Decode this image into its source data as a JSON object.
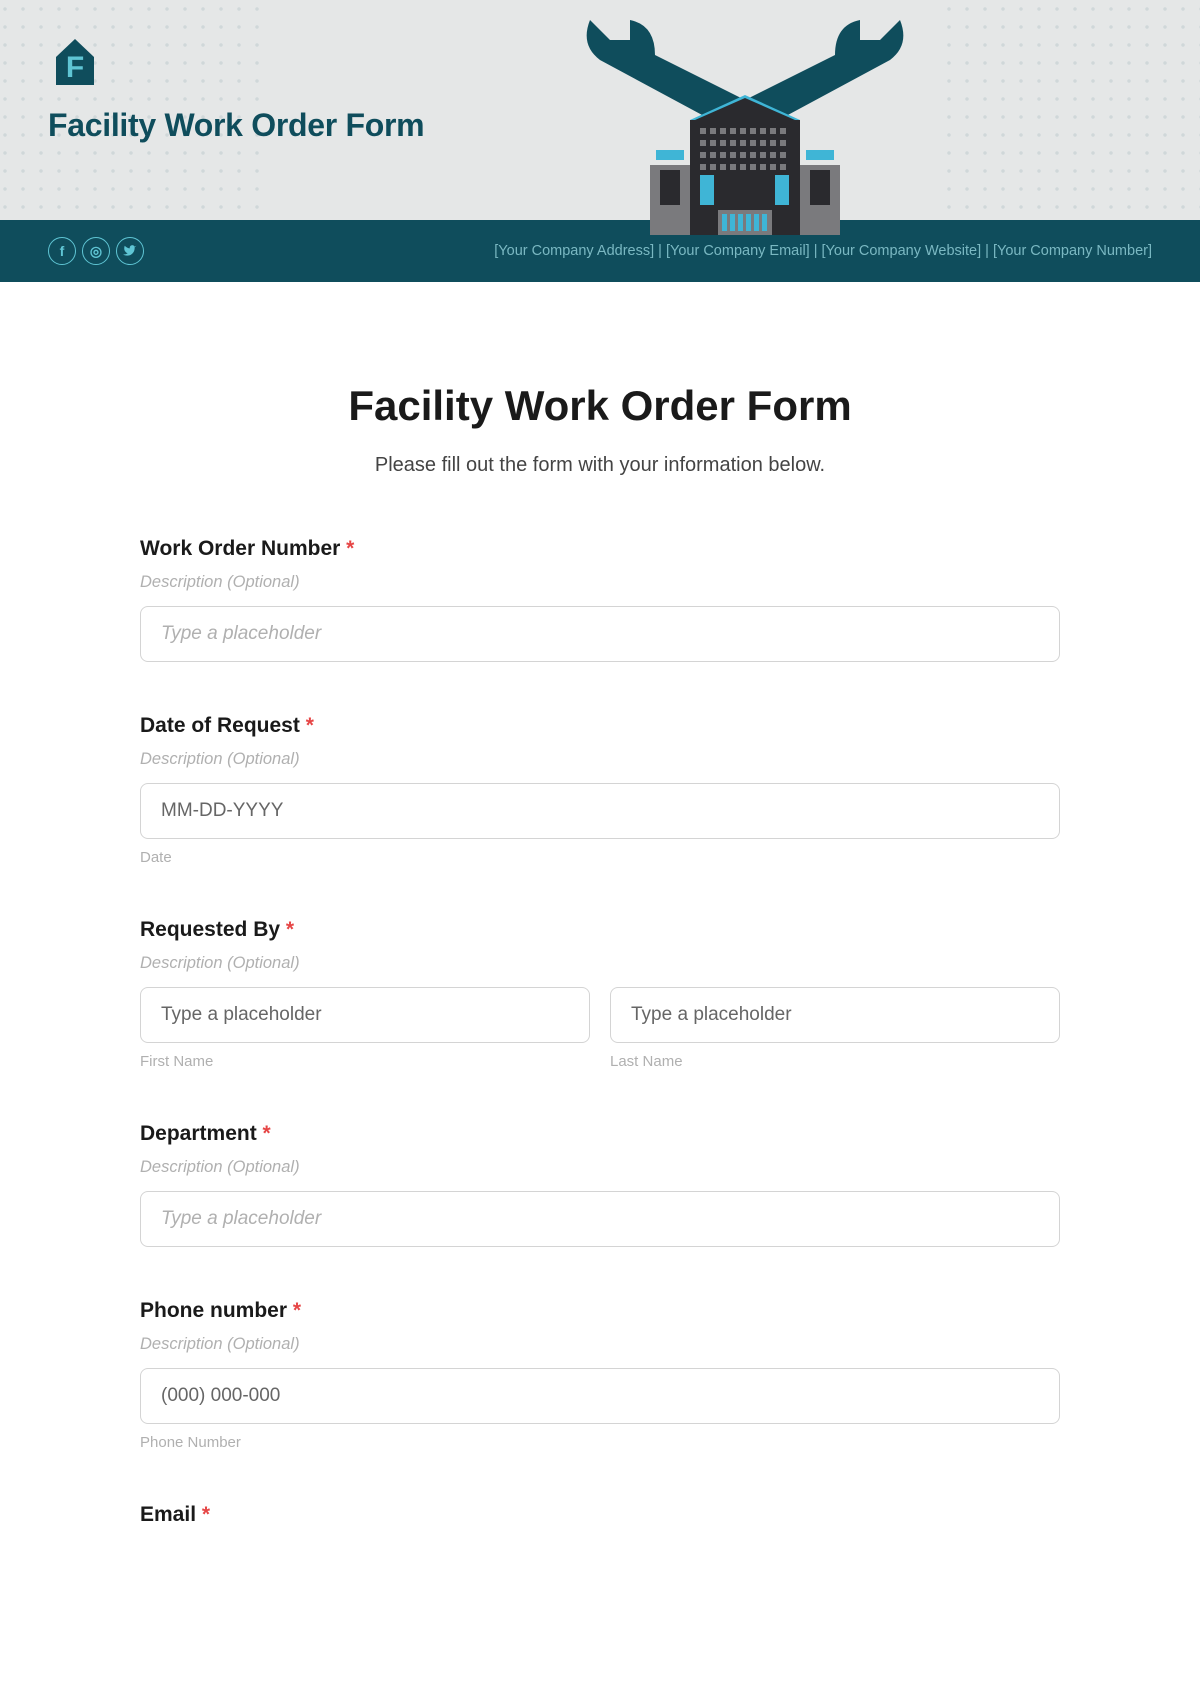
{
  "banner": {
    "title": "Facility Work Order Form"
  },
  "footer": {
    "address": "[Your Company Address]",
    "email": "[Your Company Email]",
    "website": "[Your Company Website]",
    "number": "[Your Company Number]",
    "sep": " | "
  },
  "form": {
    "title": "Facility Work Order Form",
    "subtitle": "Please fill out the form with your information below.",
    "desc_optional": "Description (Optional)",
    "placeholder_generic": "Type a placeholder",
    "fields": {
      "work_order": {
        "label": "Work Order Number"
      },
      "date_request": {
        "label": "Date of Request",
        "placeholder": "MM-DD-YYYY",
        "sub": "Date"
      },
      "requested_by": {
        "label": "Requested By",
        "sub_first": "First Name",
        "sub_last": "Last Name"
      },
      "department": {
        "label": "Department"
      },
      "phone": {
        "label": "Phone number",
        "placeholder": "(000) 000-000",
        "sub": "Phone Number"
      },
      "email": {
        "label": "Email"
      }
    },
    "required_marker": "*"
  }
}
